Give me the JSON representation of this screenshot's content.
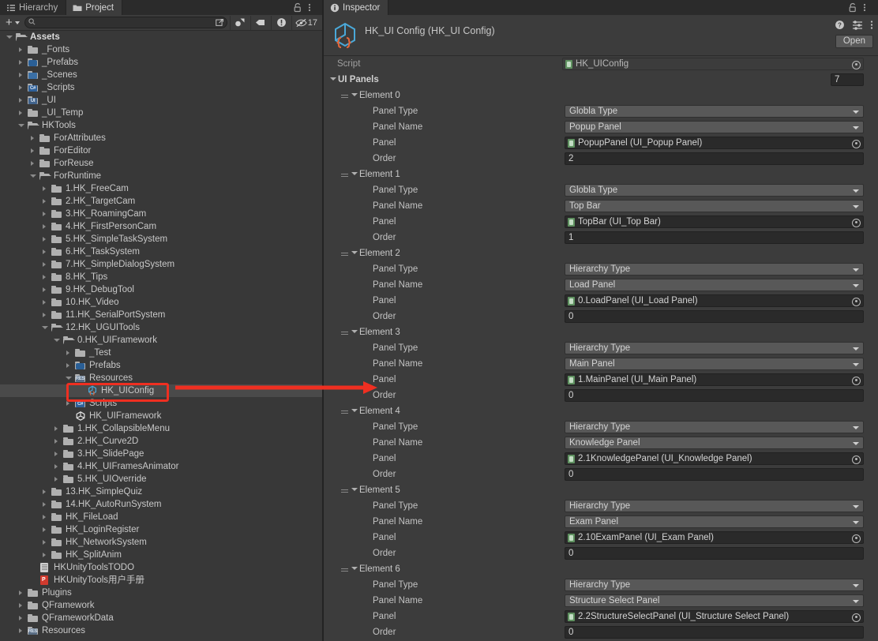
{
  "project": {
    "tabs": [
      {
        "label": "Hierarchy",
        "icon": "hierarchy-list-icon",
        "active": false
      },
      {
        "label": "Project",
        "icon": "folder-icon",
        "active": true
      }
    ],
    "window_icons": {
      "lock": "lock-icon",
      "menu": "kebab-menu-icon"
    },
    "toolbar": {
      "create_label": "+",
      "search_placeholder": "",
      "search_value": "",
      "search_icon": "search-icon",
      "icons": [
        {
          "name": "open-in-window-icon"
        },
        {
          "name": "object-filter-icon"
        },
        {
          "name": "label-filter-icon"
        },
        {
          "name": "warning-filter-icon"
        },
        {
          "name": "hidden-count-icon"
        }
      ],
      "hidden_count": "17"
    },
    "tree": [
      {
        "label": "Assets",
        "depth": 0,
        "icon": "folder-open",
        "arrow": "open",
        "bold": true
      },
      {
        "label": "_Fonts",
        "depth": 1,
        "icon": "folder",
        "arrow": "closed"
      },
      {
        "label": "_Prefabs",
        "depth": 1,
        "icon": "folder-prefab",
        "arrow": "closed"
      },
      {
        "label": "_Scenes",
        "depth": 1,
        "icon": "folder-scene",
        "arrow": "closed"
      },
      {
        "label": "_Scripts",
        "depth": 1,
        "icon": "folder-cs",
        "arrow": "closed"
      },
      {
        "label": "_UI",
        "depth": 1,
        "icon": "folder-ui",
        "arrow": "closed"
      },
      {
        "label": "_UI_Temp",
        "depth": 1,
        "icon": "folder",
        "arrow": "closed"
      },
      {
        "label": "HKTools",
        "depth": 1,
        "icon": "folder-open",
        "arrow": "open"
      },
      {
        "label": "ForAttributes",
        "depth": 2,
        "icon": "folder",
        "arrow": "closed"
      },
      {
        "label": "ForEditor",
        "depth": 2,
        "icon": "folder",
        "arrow": "closed"
      },
      {
        "label": "ForReuse",
        "depth": 2,
        "icon": "folder",
        "arrow": "closed"
      },
      {
        "label": "ForRuntime",
        "depth": 2,
        "icon": "folder-open",
        "arrow": "open"
      },
      {
        "label": "1.HK_FreeCam",
        "depth": 3,
        "icon": "folder",
        "arrow": "closed"
      },
      {
        "label": "2.HK_TargetCam",
        "depth": 3,
        "icon": "folder",
        "arrow": "closed"
      },
      {
        "label": "3.HK_RoamingCam",
        "depth": 3,
        "icon": "folder",
        "arrow": "closed"
      },
      {
        "label": "4.HK_FirstPersonCam",
        "depth": 3,
        "icon": "folder",
        "arrow": "closed"
      },
      {
        "label": "5.HK_SimpleTaskSystem",
        "depth": 3,
        "icon": "folder",
        "arrow": "closed"
      },
      {
        "label": "6.HK_TaskSystem",
        "depth": 3,
        "icon": "folder",
        "arrow": "closed"
      },
      {
        "label": "7.HK_SimpleDialogSystem",
        "depth": 3,
        "icon": "folder",
        "arrow": "closed"
      },
      {
        "label": "8.HK_Tips",
        "depth": 3,
        "icon": "folder",
        "arrow": "closed"
      },
      {
        "label": "9.HK_DebugTool",
        "depth": 3,
        "icon": "folder",
        "arrow": "closed"
      },
      {
        "label": "10.HK_Video",
        "depth": 3,
        "icon": "folder",
        "arrow": "closed"
      },
      {
        "label": "11.HK_SerialPortSystem",
        "depth": 3,
        "icon": "folder",
        "arrow": "closed"
      },
      {
        "label": "12.HK_UGUITools",
        "depth": 3,
        "icon": "folder-open",
        "arrow": "open"
      },
      {
        "label": "0.HK_UIFramework",
        "depth": 4,
        "icon": "folder-open",
        "arrow": "open"
      },
      {
        "label": "_Test",
        "depth": 5,
        "icon": "folder",
        "arrow": "closed"
      },
      {
        "label": "Prefabs",
        "depth": 5,
        "icon": "folder-prefab",
        "arrow": "closed"
      },
      {
        "label": "Resources",
        "depth": 5,
        "icon": "folder-res",
        "arrow": "open"
      },
      {
        "label": "HK_UIConfig",
        "depth": 6,
        "icon": "scriptable-object",
        "arrow": "none",
        "selected": true
      },
      {
        "label": "Scripts",
        "depth": 5,
        "icon": "folder-cs",
        "arrow": "closed"
      },
      {
        "label": "HK_UIFramework",
        "depth": 5,
        "icon": "unity-asset",
        "arrow": "none"
      },
      {
        "label": "1.HK_CollapsibleMenu",
        "depth": 4,
        "icon": "folder",
        "arrow": "closed"
      },
      {
        "label": "2.HK_Curve2D",
        "depth": 4,
        "icon": "folder",
        "arrow": "closed"
      },
      {
        "label": "3.HK_SlidePage",
        "depth": 4,
        "icon": "folder",
        "arrow": "closed"
      },
      {
        "label": "4.HK_UIFramesAnimator",
        "depth": 4,
        "icon": "folder",
        "arrow": "closed"
      },
      {
        "label": "5.HK_UIOverride",
        "depth": 4,
        "icon": "folder",
        "arrow": "closed"
      },
      {
        "label": "13.HK_SimpleQuiz",
        "depth": 3,
        "icon": "folder",
        "arrow": "closed"
      },
      {
        "label": "14.HK_AutoRunSystem",
        "depth": 3,
        "icon": "folder",
        "arrow": "closed"
      },
      {
        "label": "HK_FileLoad",
        "depth": 3,
        "icon": "folder",
        "arrow": "closed"
      },
      {
        "label": "HK_LoginRegister",
        "depth": 3,
        "icon": "folder",
        "arrow": "closed"
      },
      {
        "label": "HK_NetworkSystem",
        "depth": 3,
        "icon": "folder",
        "arrow": "closed"
      },
      {
        "label": "HK_SplitAnim",
        "depth": 3,
        "icon": "folder",
        "arrow": "closed"
      },
      {
        "label": "HKUnityToolsTODO",
        "depth": 2,
        "icon": "text-file",
        "arrow": "none"
      },
      {
        "label": "HKUnityTools用户手册",
        "depth": 2,
        "icon": "pdf-file",
        "arrow": "none"
      },
      {
        "label": "Plugins",
        "depth": 1,
        "icon": "folder",
        "arrow": "closed"
      },
      {
        "label": "QFramework",
        "depth": 1,
        "icon": "folder",
        "arrow": "closed"
      },
      {
        "label": "QFrameworkData",
        "depth": 1,
        "icon": "folder",
        "arrow": "closed"
      },
      {
        "label": "Resources",
        "depth": 1,
        "icon": "folder-res",
        "arrow": "closed"
      }
    ]
  },
  "annotation": {
    "highlight_color": "#ef2f21",
    "highlighted_item": "HK_UIConfig",
    "arrow_target": "Element 3 > Panel"
  },
  "inspector": {
    "tab_label": "Inspector",
    "tab_icon": "info-icon",
    "window_icons": {
      "lock": "lock-icon",
      "menu": "kebab-menu-icon"
    },
    "asset_icon": "scriptable-object-icon",
    "title": "HK_UI Config (HK_UI Config)",
    "header_icons": [
      {
        "name": "help-icon"
      },
      {
        "name": "preset-icon"
      },
      {
        "name": "kebab-menu-icon"
      }
    ],
    "open_button": "Open",
    "script_label": "Script",
    "script_value": "HK_UIConfig",
    "ui_panels_label": "UI Panels",
    "ui_panels_size": "7",
    "field_labels": {
      "panel_type": "Panel Type",
      "panel_name": "Panel Name",
      "panel": "Panel",
      "order": "Order"
    },
    "elements": [
      {
        "label": "Element 0",
        "panel_type": "Globla Type",
        "panel_name": "Popup Panel",
        "panel": "PopupPanel (UI_Popup Panel)",
        "order": "2"
      },
      {
        "label": "Element 1",
        "panel_type": "Globla Type",
        "panel_name": "Top Bar",
        "panel": "TopBar (UI_Top Bar)",
        "order": "1"
      },
      {
        "label": "Element 2",
        "panel_type": "Hierarchy Type",
        "panel_name": "Load Panel",
        "panel": "0.LoadPanel (UI_Load Panel)",
        "order": "0"
      },
      {
        "label": "Element 3",
        "panel_type": "Hierarchy Type",
        "panel_name": "Main Panel",
        "panel": "1.MainPanel (UI_Main Panel)",
        "order": "0"
      },
      {
        "label": "Element 4",
        "panel_type": "Hierarchy Type",
        "panel_name": "Knowledge Panel",
        "panel": "2.1KnowledgePanel (UI_Knowledge Panel)",
        "order": "0"
      },
      {
        "label": "Element 5",
        "panel_type": "Hierarchy Type",
        "panel_name": "Exam Panel",
        "panel": "2.10ExamPanel (UI_Exam Panel)",
        "order": "0"
      },
      {
        "label": "Element 6",
        "panel_type": "Hierarchy Type",
        "panel_name": "Structure Select Panel",
        "panel": "2.2StructureSelectPanel (UI_Structure Select Panel)",
        "order": "0"
      }
    ]
  }
}
